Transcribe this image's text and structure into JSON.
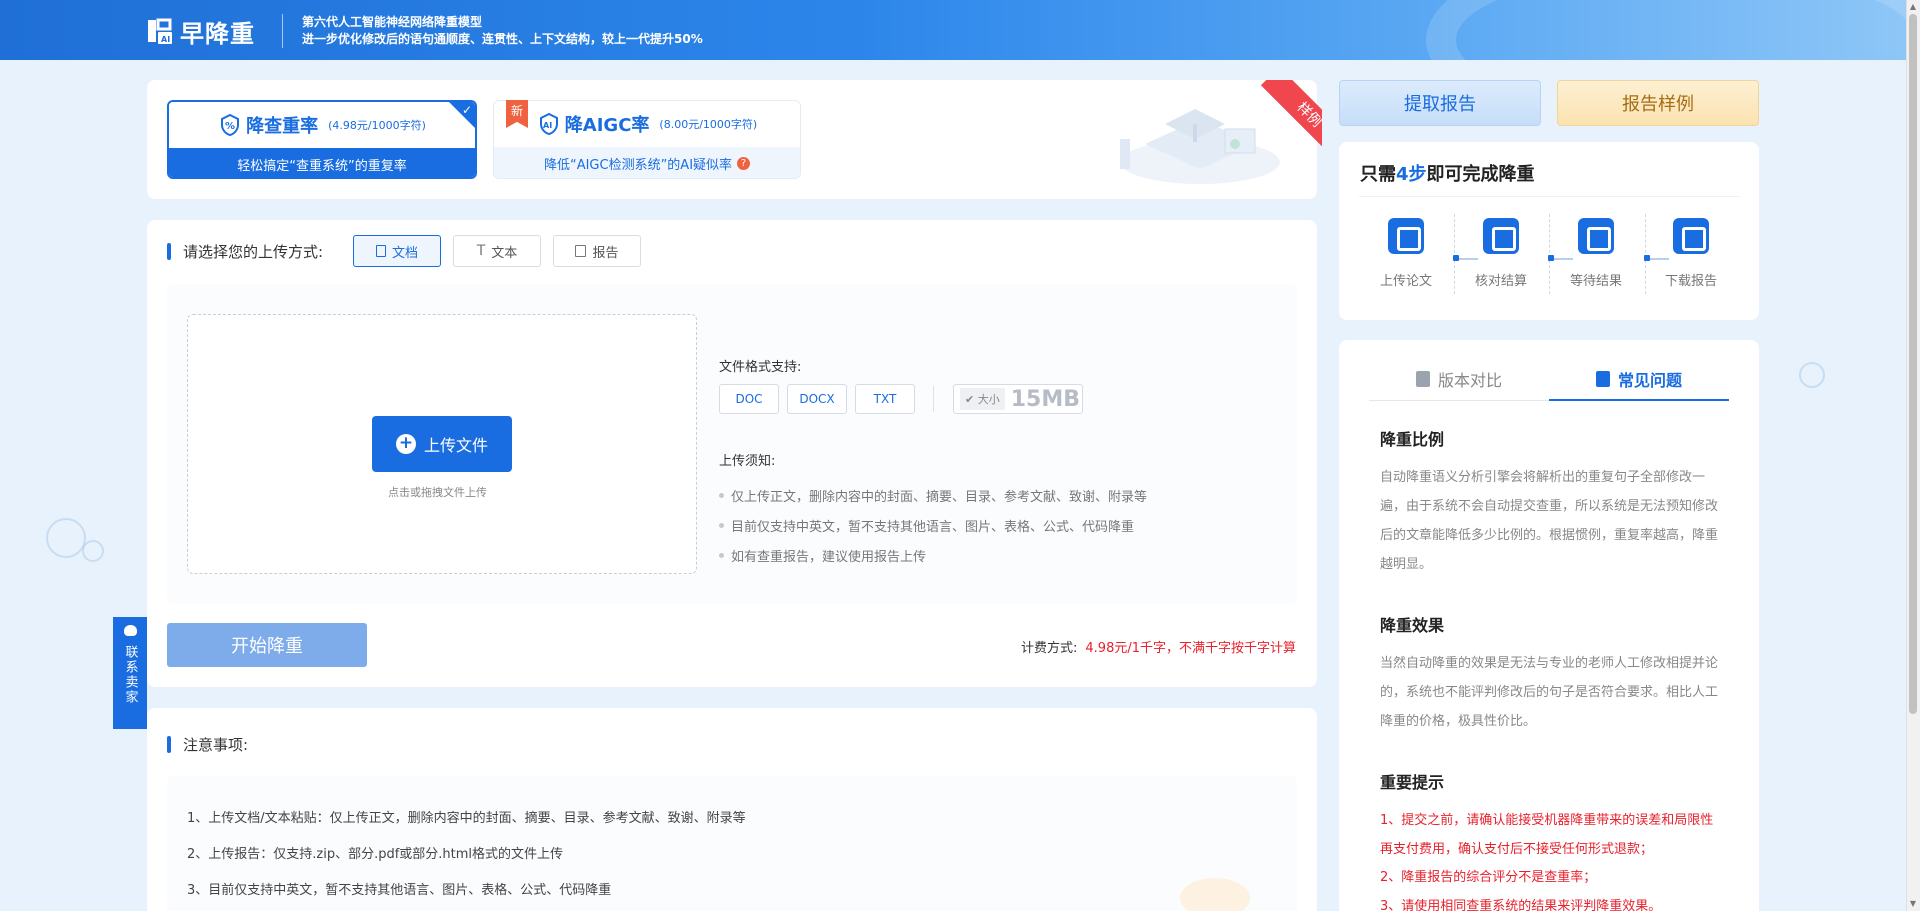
{
  "header": {
    "logo_text": "早降重",
    "slogan_line1": "第六代人工智能神经网络降重模型",
    "slogan_line2": "进一步优化修改后的语句通顺度、连贯性、上下文结构，较上一代提升50%"
  },
  "modes": [
    {
      "title": "降查重率",
      "price": "(4.98元/1000字符)",
      "subtitle": "轻松搞定“查重系统”的重复率",
      "icon": "percent-shield-icon",
      "selected": true
    },
    {
      "title": "降AIGC率",
      "price": "(8.00元/1000字符)",
      "subtitle": "降低“AIGC检测系统”的AI疑似率",
      "icon": "ai-shield-icon",
      "badge": "新",
      "selected": false
    }
  ],
  "sample_ribbon": "样例",
  "upload": {
    "label": "请选择您的上传方式:",
    "tabs": [
      {
        "label": "文档",
        "icon": "document-icon",
        "active": true
      },
      {
        "label": "文本",
        "icon": "text-icon",
        "active": false
      },
      {
        "label": "报告",
        "icon": "report-icon",
        "active": false
      }
    ],
    "upload_button": "上传文件",
    "drop_hint": "点击或拖拽文件上传",
    "formats_label": "文件格式支持:",
    "formats": [
      "DOC",
      "DOCX",
      "TXT"
    ],
    "size_label": "大小",
    "size_value": "15MB",
    "notice_label": "上传须知:",
    "notices": [
      "仅上传正文，删除内容中的封面、摘要、目录、参考文献、致谢、附录等",
      "目前仅支持中英文，暂不支持其他语言、图片、表格、公式、代码降重",
      "如有查重报告，建议使用报告上传"
    ],
    "start_button": "开始降重",
    "fee_label": "计费方式:",
    "fee_value": "4.98元/1千字，不满千字按千字计算"
  },
  "contact": "联系卖家",
  "notes": {
    "label": "注意事项:",
    "items": [
      "1、上传文档/文本粘贴：仅上传正文，删除内容中的封面、摘要、目录、参考文献、致谢、附录等",
      "2、上传报告：仅支持.zip、部分.pdf或部分.html格式的文件上传",
      "3、目前仅支持中英文，暂不支持其他语言、图片、表格、公式、代码降重"
    ]
  },
  "right": {
    "extract_report": "提取报告",
    "sample_report": "报告样例",
    "steps_title_pre": "只需",
    "steps_title_num": "4步",
    "steps_title_post": "即可完成降重",
    "steps": [
      {
        "label": "上传论文",
        "icon": "upload-icon"
      },
      {
        "label": "核对结算",
        "icon": "wallet-icon"
      },
      {
        "label": "等待结果",
        "icon": "clock-icon"
      },
      {
        "label": "下载报告",
        "icon": "download-icon"
      }
    ],
    "tabs": [
      {
        "label": "版本对比",
        "icon": "file-icon",
        "active": false
      },
      {
        "label": "常见问题",
        "icon": "chat-icon",
        "active": true
      }
    ],
    "faq": [
      {
        "title": "降重比例",
        "body": "自动降重语义分析引擎会将解析出的重复句子全部修改一遍，由于系统不会自动提交查重，所以系统是无法预知修改后的文章能降低多少比例的。根据惯例，重复率越高，降重越明显。"
      },
      {
        "title": "降重效果",
        "body": "当然自动降重的效果是无法与专业的老师人工修改相提并论的，系统也不能评判修改后的句子是否符合要求。相比人工降重的价格，极具性价比。"
      },
      {
        "title": "重要提示",
        "items": [
          "1、提交之前，请确认能接受机器降重带来的误差和局限性再支付费用，确认支付后不接受任何形式退款；",
          "2、降重报告的综合评分不是查重率；",
          "3、请使用相同查重系统的结果来评判降重效果。"
        ]
      }
    ]
  },
  "colors": {
    "accent": "#1a6de0",
    "alert": "#e8212c",
    "gold": "#a66d14"
  }
}
